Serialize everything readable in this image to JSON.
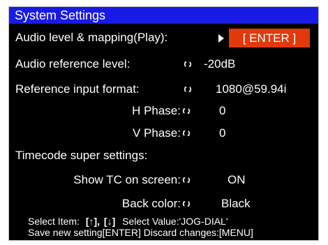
{
  "window": {
    "title": "System Settings"
  },
  "settings": {
    "audio_mapping": {
      "label": "Audio level & mapping(Play):",
      "button": "[ ENTER ]"
    },
    "audio_ref": {
      "label": "Audio reference level:",
      "value": "-20dB"
    },
    "ref_input": {
      "label": "Reference input format:",
      "value": "1080@59.94i"
    },
    "h_phase": {
      "label": "H Phase:",
      "value": "0"
    },
    "v_phase": {
      "label": "V Phase:",
      "value": "0"
    },
    "timecode_header": "Timecode super settings:",
    "show_tc": {
      "label": "Show TC on screen:",
      "value": "ON"
    },
    "back_color": {
      "label": "Back color:",
      "value": "Black"
    }
  },
  "help": {
    "select_item_label": "Select Item:",
    "up_key": "[↑],",
    "down_key": "[↓]",
    "select_value": "Select Value:'JOG-DIAL'",
    "line2": "Save new setting[ENTER] Discard changes:[MENU]"
  },
  "icons": {
    "jog": "jog-dial-icon",
    "arrow": "play-arrow-icon"
  },
  "colors": {
    "titlebar": "#1a1ae6",
    "enter_button": "#e03a0c",
    "background": "#000000",
    "text": "#ffffff"
  }
}
